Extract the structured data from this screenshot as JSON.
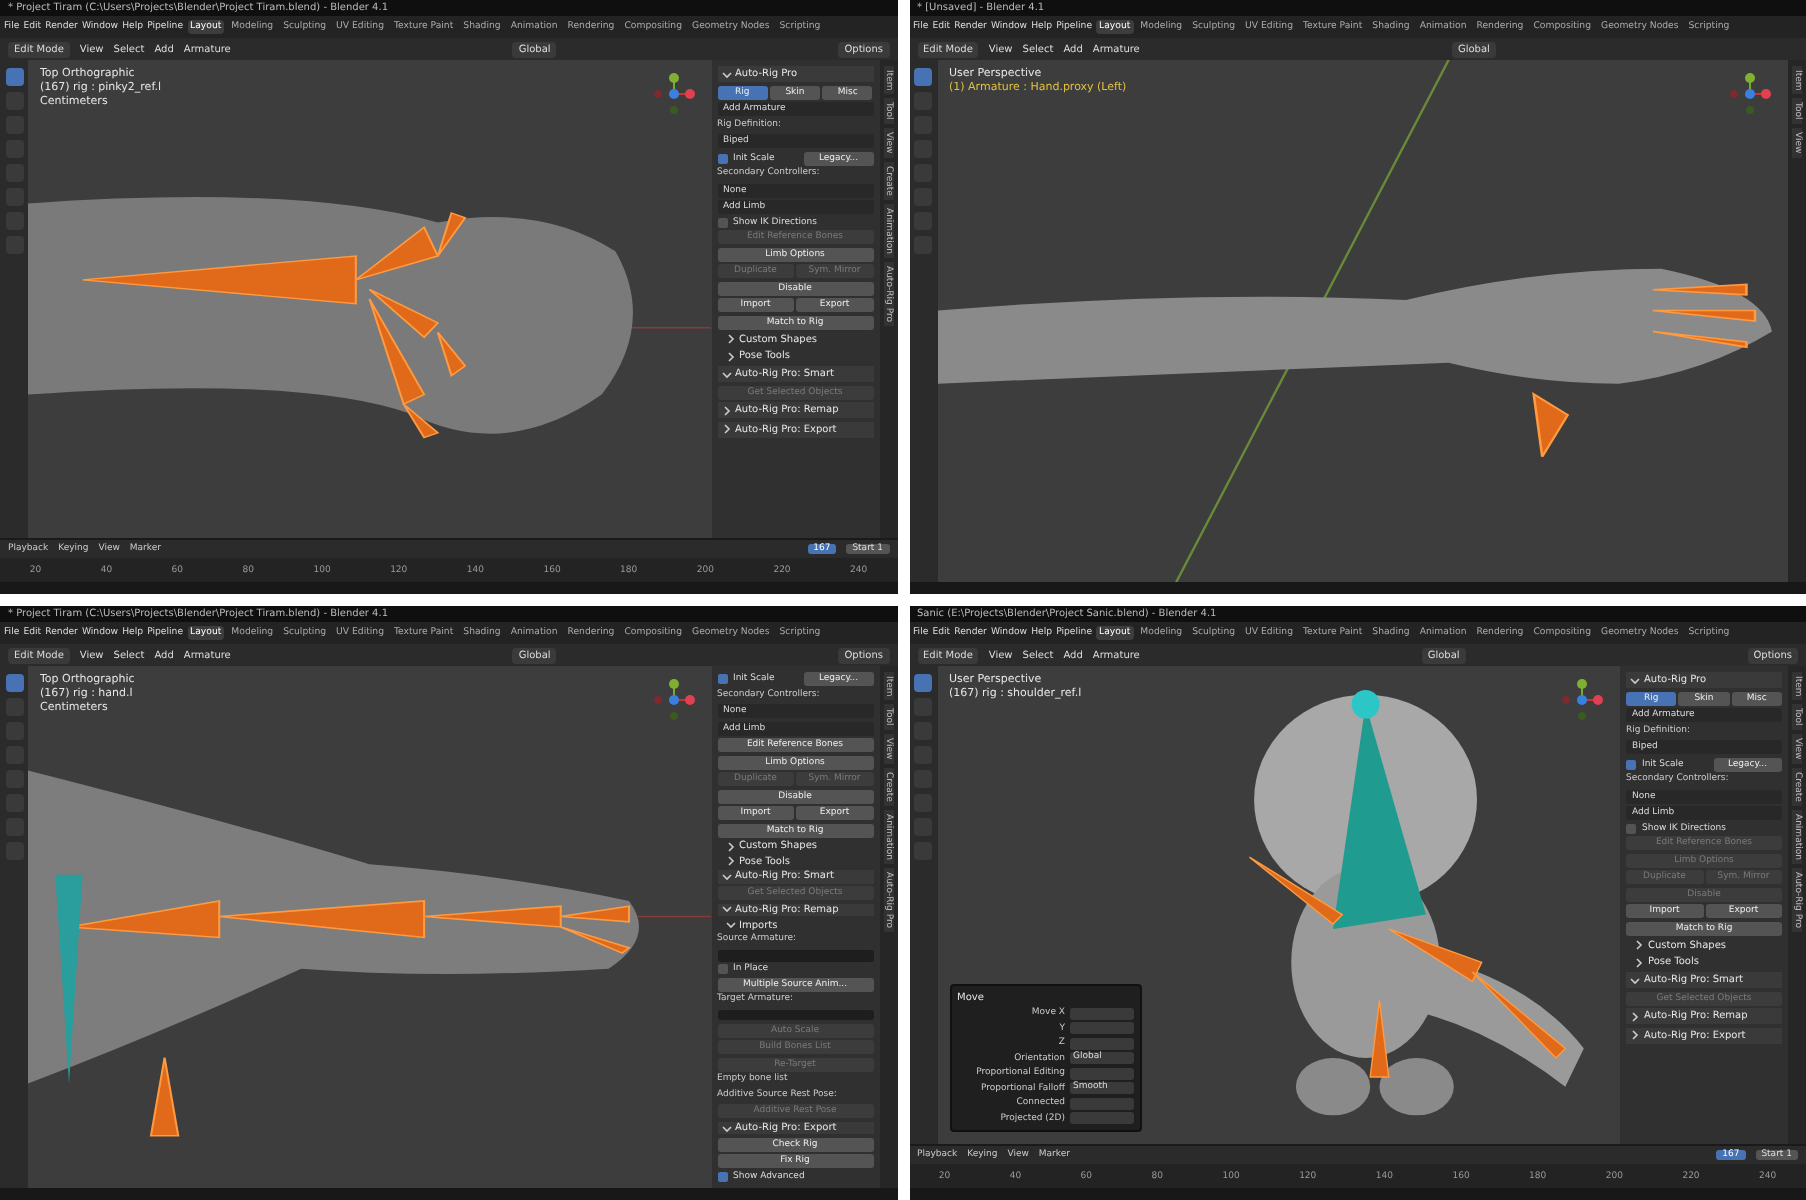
{
  "windows": [
    {
      "title": "* Project Tiram (C:\\Users\\Projects\\Blender\\Project Tiram.blend) - Blender 4.1",
      "menus": [
        "File",
        "Edit",
        "Render",
        "Window",
        "Help",
        "Pipeline"
      ],
      "workspaces": [
        {
          "label": "Layout",
          "selected": true
        },
        {
          "label": "Modeling",
          "selected": false
        },
        {
          "label": "Sculpting",
          "selected": false
        },
        {
          "label": "UV Editing",
          "selected": false
        },
        {
          "label": "Texture Paint",
          "selected": false
        },
        {
          "label": "Shading",
          "selected": false
        },
        {
          "label": "Animation",
          "selected": false
        },
        {
          "label": "Rendering",
          "selected": false
        },
        {
          "label": "Compositing",
          "selected": false
        },
        {
          "label": "Geometry Nodes",
          "selected": false
        },
        {
          "label": "Scripting",
          "selected": false
        }
      ],
      "mode": "Edit Mode",
      "header_menus": [
        "View",
        "Select",
        "Add",
        "Armature"
      ],
      "orientation": "Global",
      "options": "Options",
      "overlay_lines": [
        {
          "text": "Top Orthographic",
          "kind": "plain"
        },
        {
          "text": "(167) rig : pinky2_ref.l",
          "kind": "plain"
        },
        {
          "text": "Centimeters",
          "kind": "plain"
        }
      ],
      "panel": [
        {
          "kind": "header",
          "label": "Auto-Rig Pro",
          "expanded": true
        },
        {
          "kind": "tabs",
          "tabs": [
            {
              "label": "Rig",
              "selected": true
            },
            {
              "label": "Skin",
              "selected": false
            },
            {
              "label": "Misc",
              "selected": false
            }
          ]
        },
        {
          "kind": "dropdown",
          "value": "Add Armature"
        },
        {
          "kind": "label",
          "text": "Rig Definition:"
        },
        {
          "kind": "dropdown",
          "value": "Biped"
        },
        {
          "kind": "checkpair",
          "label": "Init Scale",
          "checked": true,
          "button": "Legacy..."
        },
        {
          "kind": "label",
          "text": "Secondary Controllers:"
        },
        {
          "kind": "dropdown",
          "value": "None"
        },
        {
          "kind": "dropdown",
          "value": "Add Limb"
        },
        {
          "kind": "checkbox",
          "label": "Show IK Directions",
          "checked": false
        },
        {
          "kind": "button",
          "label": "Edit Reference Bones",
          "disabled": true
        },
        {
          "kind": "button",
          "label": "Limb Options",
          "disabled": false
        },
        {
          "kind": "pair",
          "buttons": [
            {
              "label": "Duplicate",
              "disabled": true
            },
            {
              "label": "Sym. Mirror",
              "disabled": true
            }
          ]
        },
        {
          "kind": "button",
          "label": "Disable",
          "disabled": false
        },
        {
          "kind": "pair",
          "buttons": [
            {
              "label": "Import",
              "disabled": false
            },
            {
              "label": "Export",
              "disabled": false
            }
          ]
        },
        {
          "kind": "button",
          "label": "Match to Rig",
          "disabled": false
        },
        {
          "kind": "section",
          "label": "Custom Shapes",
          "expanded": false
        },
        {
          "kind": "section",
          "label": "Pose Tools",
          "expanded": false
        },
        {
          "kind": "header",
          "label": "Auto-Rig Pro: Smart",
          "expanded": true
        },
        {
          "kind": "button",
          "label": "Get Selected Objects",
          "disabled": true
        },
        {
          "kind": "header",
          "label": "Auto-Rig Pro: Remap",
          "expanded": false
        },
        {
          "kind": "header",
          "label": "Auto-Rig Pro: Export",
          "expanded": false
        }
      ],
      "side_tabs": [
        "Item",
        "Tool",
        "View",
        "Create",
        "Animation",
        "Auto-Rig Pro"
      ],
      "timeline": {
        "menus": [
          "Playback",
          "Keying",
          "View",
          "Marker"
        ],
        "current": "167",
        "start_label": "Start",
        "start": "1",
        "ticks": [
          "20",
          "40",
          "60",
          "80",
          "100",
          "120",
          "140",
          "160",
          "180",
          "200",
          "220",
          "240"
        ]
      }
    },
    {
      "title": "* [Unsaved] - Blender 4.1",
      "menus": [
        "File",
        "Edit",
        "Render",
        "Window",
        "Help",
        "Pipeline"
      ],
      "workspaces": [
        {
          "label": "Layout",
          "selected": true
        },
        {
          "label": "Modeling",
          "selected": false
        },
        {
          "label": "Sculpting",
          "selected": false
        },
        {
          "label": "UV Editing",
          "selected": false
        },
        {
          "label": "Texture Paint",
          "selected": false
        },
        {
          "label": "Shading",
          "selected": false
        },
        {
          "label": "Animation",
          "selected": false
        },
        {
          "label": "Rendering",
          "selected": false
        },
        {
          "label": "Compositing",
          "selected": false
        },
        {
          "label": "Geometry Nodes",
          "selected": false
        },
        {
          "label": "Scripting",
          "selected": false
        }
      ],
      "mode": "Edit Mode",
      "header_menus": [
        "View",
        "Select",
        "Add",
        "Armature"
      ],
      "orientation": "Global",
      "overlay_lines": [
        {
          "text": "User Perspective",
          "kind": "plain"
        },
        {
          "text": "(1) Armature : Hand.proxy (Left)",
          "kind": "highlight"
        }
      ],
      "side_tabs": [
        "Item",
        "Tool",
        "View"
      ]
    },
    {
      "title": "* Project Tiram (C:\\Users\\Projects\\Blender\\Project Tiram.blend) - Blender 4.1",
      "menus": [
        "File",
        "Edit",
        "Render",
        "Window",
        "Help",
        "Pipeline"
      ],
      "workspaces": [
        {
          "label": "Layout",
          "selected": true
        },
        {
          "label": "Modeling",
          "selected": false
        },
        {
          "label": "Sculpting",
          "selected": false
        },
        {
          "label": "UV Editing",
          "selected": false
        },
        {
          "label": "Texture Paint",
          "selected": false
        },
        {
          "label": "Shading",
          "selected": false
        },
        {
          "label": "Animation",
          "selected": false
        },
        {
          "label": "Rendering",
          "selected": false
        },
        {
          "label": "Compositing",
          "selected": false
        },
        {
          "label": "Geometry Nodes",
          "selected": false
        },
        {
          "label": "Scripting",
          "selected": false
        }
      ],
      "mode": "Edit Mode",
      "header_menus": [
        "View",
        "Select",
        "Add",
        "Armature"
      ],
      "orientation": "Global",
      "options": "Options",
      "overlay_lines": [
        {
          "text": "Top Orthographic",
          "kind": "plain"
        },
        {
          "text": "(167) rig : hand.l",
          "kind": "plain"
        },
        {
          "text": "Centimeters",
          "kind": "plain"
        }
      ],
      "panel": [
        {
          "kind": "checkpair",
          "label": "Init Scale",
          "checked": true,
          "button": "Legacy..."
        },
        {
          "kind": "label",
          "text": "Secondary Controllers:"
        },
        {
          "kind": "dropdown",
          "value": "None"
        },
        {
          "kind": "dropdown",
          "value": "Add Limb"
        },
        {
          "kind": "button",
          "label": "Edit Reference Bones",
          "disabled": false
        },
        {
          "kind": "button",
          "label": "Limb Options",
          "disabled": false
        },
        {
          "kind": "pair",
          "buttons": [
            {
              "label": "Duplicate",
              "disabled": true
            },
            {
              "label": "Sym. Mirror",
              "disabled": true
            }
          ]
        },
        {
          "kind": "button",
          "label": "Disable",
          "disabled": false
        },
        {
          "kind": "pair",
          "buttons": [
            {
              "label": "Import",
              "disabled": false
            },
            {
              "label": "Export",
              "disabled": false
            }
          ]
        },
        {
          "kind": "button",
          "label": "Match to Rig",
          "disabled": false
        },
        {
          "kind": "section",
          "label": "Custom Shapes",
          "expanded": false
        },
        {
          "kind": "section",
          "label": "Pose Tools",
          "expanded": false
        },
        {
          "kind": "header",
          "label": "Auto-Rig Pro: Smart",
          "expanded": true
        },
        {
          "kind": "button",
          "label": "Get Selected Objects",
          "disabled": true
        },
        {
          "kind": "header",
          "label": "Auto-Rig Pro: Remap",
          "expanded": true
        },
        {
          "kind": "section",
          "label": "Imports",
          "expanded": true
        },
        {
          "kind": "label",
          "text": "Source Armature:"
        },
        {
          "kind": "field"
        },
        {
          "kind": "checkbox",
          "label": "In Place",
          "checked": false
        },
        {
          "kind": "button",
          "label": "Multiple Source Anim...",
          "disabled": false
        },
        {
          "kind": "label",
          "text": "Target Armature:"
        },
        {
          "kind": "field"
        },
        {
          "kind": "button",
          "label": "Auto Scale",
          "disabled": true
        },
        {
          "kind": "button",
          "label": "Build Bones List",
          "disabled": true
        },
        {
          "kind": "button",
          "label": "Re-Target",
          "disabled": true
        },
        {
          "kind": "label",
          "text": "Empty bone list"
        },
        {
          "kind": "label",
          "text": "Additive Source Rest Pose:"
        },
        {
          "kind": "button",
          "label": "Additive Rest Pose",
          "disabled": true
        },
        {
          "kind": "header",
          "label": "Auto-Rig Pro: Export",
          "expanded": true
        },
        {
          "kind": "button",
          "label": "Check Rig",
          "disabled": false
        },
        {
          "kind": "button",
          "label": "Fix Rig",
          "disabled": false
        },
        {
          "kind": "checkbox",
          "label": "Show Advanced",
          "checked": true
        }
      ],
      "side_tabs": [
        "Item",
        "Tool",
        "View",
        "Create",
        "Animation",
        "Auto-Rig Pro"
      ]
    },
    {
      "title": "Sanic (E:\\Projects\\Blender\\Project Sanic.blend) - Blender 4.1",
      "menus": [
        "File",
        "Edit",
        "Render",
        "Window",
        "Help",
        "Pipeline"
      ],
      "workspaces": [
        {
          "label": "Layout",
          "selected": true
        },
        {
          "label": "Modeling",
          "selected": false
        },
        {
          "label": "Sculpting",
          "selected": false
        },
        {
          "label": "UV Editing",
          "selected": false
        },
        {
          "label": "Texture Paint",
          "selected": false
        },
        {
          "label": "Shading",
          "selected": false
        },
        {
          "label": "Animation",
          "selected": false
        },
        {
          "label": "Rendering",
          "selected": false
        },
        {
          "label": "Compositing",
          "selected": false
        },
        {
          "label": "Geometry Nodes",
          "selected": false
        },
        {
          "label": "Scripting",
          "selected": false
        }
      ],
      "mode": "Edit Mode",
      "header_menus": [
        "View",
        "Select",
        "Add",
        "Armature"
      ],
      "orientation": "Global",
      "options": "Options",
      "overlay_lines": [
        {
          "text": "User Perspective",
          "kind": "plain"
        },
        {
          "text": "(167) rig : shoulder_ref.l",
          "kind": "plain"
        }
      ],
      "popup": {
        "title": "Move",
        "rows": [
          {
            "label": "Move X"
          },
          {
            "label": "Y"
          },
          {
            "label": "Z"
          },
          {
            "label": "Orientation",
            "value": "Global"
          },
          {
            "label": "Proportional Editing"
          },
          {
            "label": "Proportional Falloff",
            "value": "Smooth"
          },
          {
            "label": "Connected"
          },
          {
            "label": "Projected (2D)"
          }
        ]
      },
      "panel": [
        {
          "kind": "header",
          "label": "Auto-Rig Pro",
          "expanded": true
        },
        {
          "kind": "tabs",
          "tabs": [
            {
              "label": "Rig",
              "selected": true
            },
            {
              "label": "Skin",
              "selected": false
            },
            {
              "label": "Misc",
              "selected": false
            }
          ]
        },
        {
          "kind": "dropdown",
          "value": "Add Armature"
        },
        {
          "kind": "label",
          "text": "Rig Definition:"
        },
        {
          "kind": "dropdown",
          "value": "Biped"
        },
        {
          "kind": "checkpair",
          "label": "Init Scale",
          "checked": true,
          "button": "Legacy..."
        },
        {
          "kind": "label",
          "text": "Secondary Controllers:"
        },
        {
          "kind": "dropdown",
          "value": "None"
        },
        {
          "kind": "dropdown",
          "value": "Add Limb"
        },
        {
          "kind": "checkbox",
          "label": "Show IK Directions",
          "checked": false
        },
        {
          "kind": "button",
          "label": "Edit Reference Bones",
          "disabled": true
        },
        {
          "kind": "button",
          "label": "Limb Options",
          "disabled": true
        },
        {
          "kind": "pair",
          "buttons": [
            {
              "label": "Duplicate",
              "disabled": true
            },
            {
              "label": "Sym. Mirror",
              "disabled": true
            }
          ]
        },
        {
          "kind": "button",
          "label": "Disable",
          "disabled": true
        },
        {
          "kind": "pair",
          "buttons": [
            {
              "label": "Import",
              "disabled": false
            },
            {
              "label": "Export",
              "disabled": false
            }
          ]
        },
        {
          "kind": "button",
          "label": "Match to Rig",
          "disabled": false
        },
        {
          "kind": "section",
          "label": "Custom Shapes",
          "expanded": false
        },
        {
          "kind": "section",
          "label": "Pose Tools",
          "expanded": false
        },
        {
          "kind": "header",
          "label": "Auto-Rig Pro: Smart",
          "expanded": true
        },
        {
          "kind": "button",
          "label": "Get Selected Objects",
          "disabled": true
        },
        {
          "kind": "header",
          "label": "Auto-Rig Pro: Remap",
          "expanded": false
        },
        {
          "kind": "header",
          "label": "Auto-Rig Pro: Export",
          "expanded": false
        }
      ],
      "side_tabs": [
        "Item",
        "Tool",
        "View",
        "Create",
        "Animation",
        "Auto-Rig Pro"
      ],
      "timeline": {
        "menus": [
          "Playback",
          "Keying",
          "View",
          "Marker"
        ],
        "current": "167",
        "start_label": "Start",
        "start": "1",
        "ticks": [
          "20",
          "40",
          "60",
          "80",
          "100",
          "120",
          "140",
          "160",
          "180",
          "200",
          "220",
          "240"
        ]
      }
    }
  ]
}
